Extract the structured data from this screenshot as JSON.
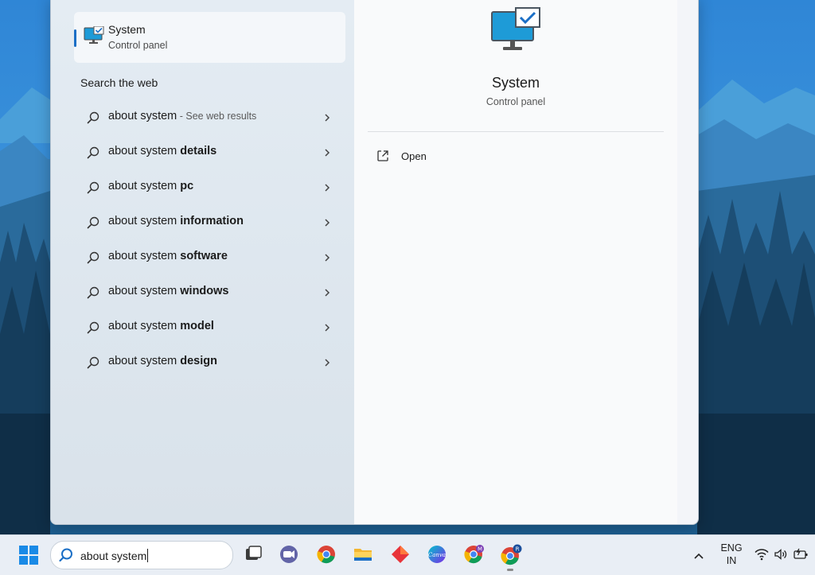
{
  "best_match": {
    "title": "System",
    "subtitle": "Control panel",
    "icon": "monitor-check-icon"
  },
  "web_section": {
    "title": "Search the web",
    "results": [
      {
        "prefix": "about system",
        "bold": "",
        "hint": " - See web results"
      },
      {
        "prefix": "about system ",
        "bold": "details",
        "hint": ""
      },
      {
        "prefix": "about system ",
        "bold": "pc",
        "hint": ""
      },
      {
        "prefix": "about system ",
        "bold": "information",
        "hint": ""
      },
      {
        "prefix": "about system ",
        "bold": "software",
        "hint": ""
      },
      {
        "prefix": "about system ",
        "bold": "windows",
        "hint": ""
      },
      {
        "prefix": "about system ",
        "bold": "model",
        "hint": ""
      },
      {
        "prefix": "about system ",
        "bold": "design",
        "hint": ""
      }
    ]
  },
  "preview": {
    "title": "System",
    "subtitle": "Control panel",
    "open_label": "Open"
  },
  "taskbar": {
    "search_value": "about system",
    "apps": [
      "task-view-icon",
      "teams-icon",
      "chrome-icon",
      "file-explorer-icon",
      "app-icon",
      "canva-icon",
      "chrome-profile-m-icon",
      "chrome-profile-r-icon"
    ],
    "language": {
      "line1": "ENG",
      "line2": "IN"
    }
  },
  "colors": {
    "accent": "#1b6fc6",
    "panel": "#f3f5f9",
    "taskbar": "#e9eef5"
  }
}
